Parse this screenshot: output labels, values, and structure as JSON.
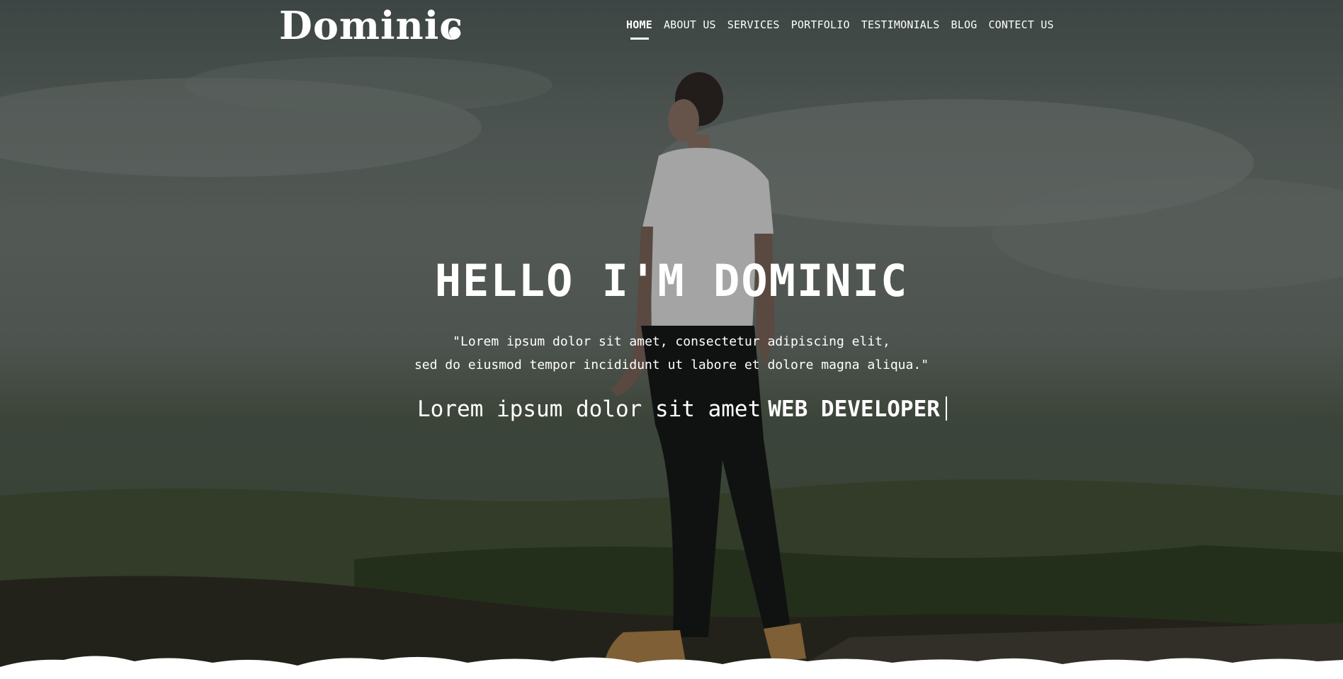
{
  "header": {
    "logo_text": "Dominic",
    "nav": [
      {
        "label": "HOME",
        "active": true
      },
      {
        "label": "ABOUT US",
        "active": false
      },
      {
        "label": "SERVICES",
        "active": false
      },
      {
        "label": "PORTFOLIO",
        "active": false
      },
      {
        "label": "TESTIMONIALS",
        "active": false
      },
      {
        "label": "BLOG",
        "active": false
      },
      {
        "label": "CONTECT US",
        "active": false
      }
    ]
  },
  "hero": {
    "headline": "HELLO I'M DOMINIC",
    "quote_line1": "\"Lorem ipsum dolor sit amet, consectetur adipiscing elit,",
    "quote_line2": "sed do eiusmod tempor incididunt ut labore et dolore magna aliqua.\"",
    "tagline_prefix": "Lorem ipsum dolor sit amet",
    "tagline_role": "WEB DEVELOPER"
  },
  "colors": {
    "text": "#ffffff",
    "overlay": "#000000",
    "wave": "#ffffff"
  }
}
